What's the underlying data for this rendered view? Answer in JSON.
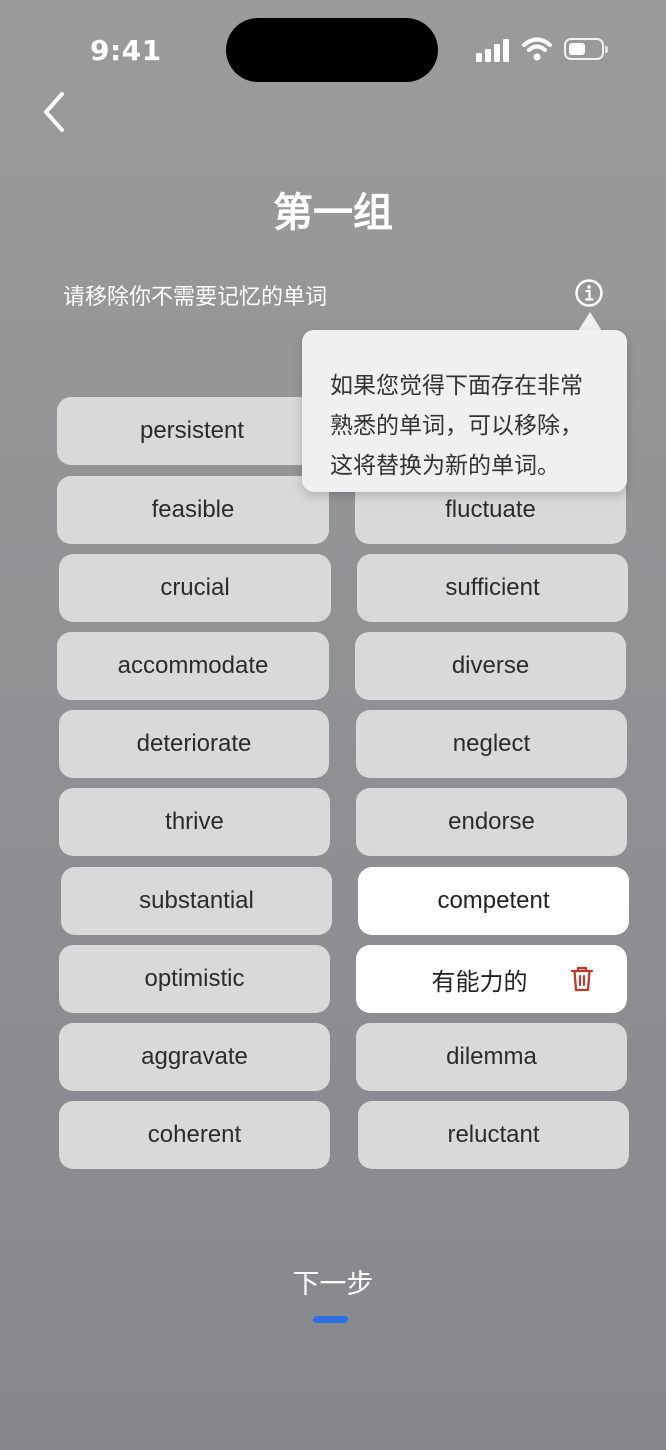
{
  "status_bar": {
    "time": "9:41"
  },
  "header": {
    "title": "第一组"
  },
  "instruction": {
    "text": "请移除你不需要记忆的单词"
  },
  "tooltip": {
    "lines": [
      "如果您觉得下面存在非常",
      "熟悉的单词，可以移除，",
      "这将替换为新的单词。"
    ]
  },
  "words": {
    "left": [
      "persistent",
      "feasible",
      "crucial",
      "accommodate",
      "deteriorate",
      "thrive",
      "substantial",
      "optimistic",
      "aggravate",
      "coherent"
    ],
    "right": [
      "",
      "fluctuate",
      "sufficient",
      "diverse",
      "neglect",
      "endorse",
      "competent",
      "有能力的",
      "dilemma",
      "reluctant"
    ]
  },
  "footer": {
    "next_label": "下一步"
  },
  "colors": {
    "accent": "#2f6fe6",
    "delete": "#c0392b",
    "chip": "#d9d9d9",
    "chip_selected": "#ffffff"
  },
  "icons": {
    "back": "chevron-left-icon",
    "info": "info-icon",
    "delete": "trash-icon"
  }
}
